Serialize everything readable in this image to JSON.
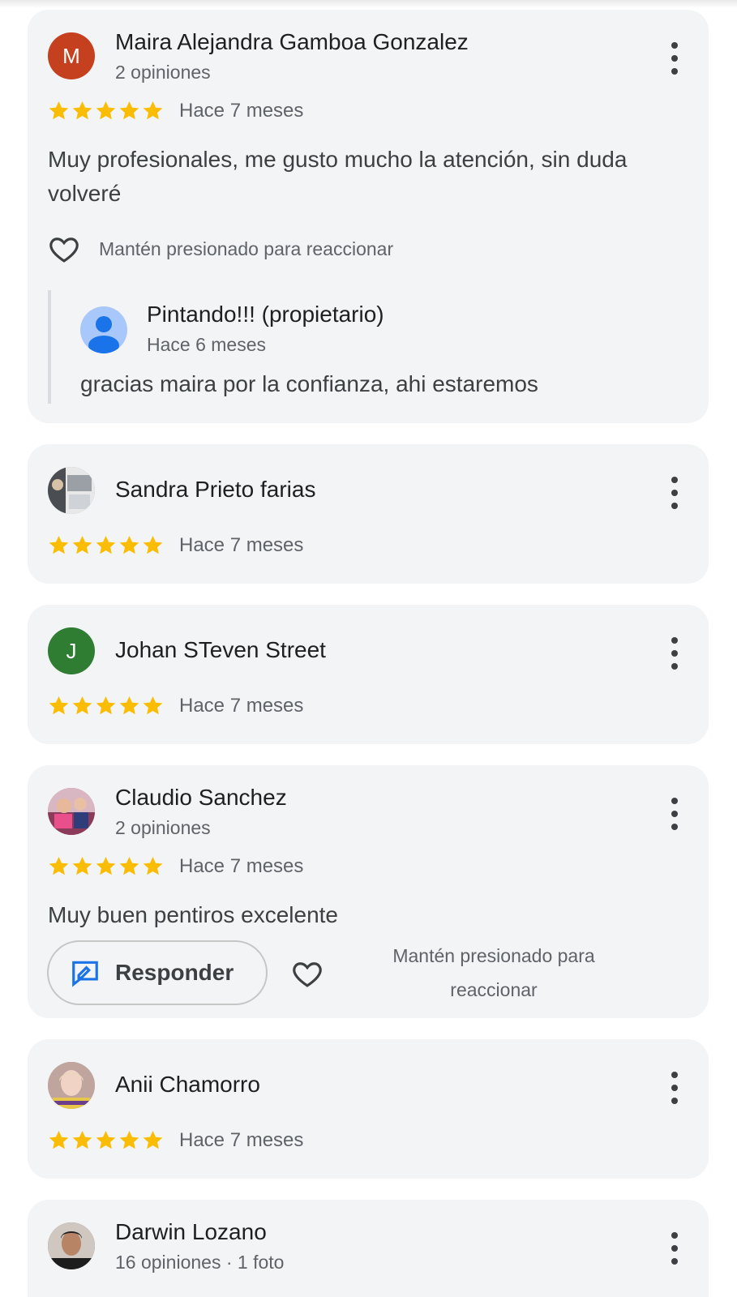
{
  "reviews": [
    {
      "name": "Maira Alejandra Gamboa Gonzalez",
      "initial": "M",
      "avatar_color": "#c5401f",
      "meta": "2 opiniones",
      "rating": 5,
      "date": "Hace 7 meses",
      "text": "Muy profesionales, me gusto mucho la atención, sin duda volveré",
      "react_label": "Mantén presionado para reaccionar",
      "owner_reply": {
        "name": "Pintando!!! (propietario)",
        "date": "Hace 6 meses",
        "text": "gracias maira por la confianza, ahi estaremos"
      }
    },
    {
      "name": "Sandra Prieto farias",
      "avatar": "photo",
      "rating": 5,
      "date": "Hace 7 meses"
    },
    {
      "name": "Johan STeven Street",
      "initial": "J",
      "avatar_color": "#2e7d32",
      "rating": 5,
      "date": "Hace 7 meses"
    },
    {
      "name": "Claudio Sanchez",
      "avatar": "photo",
      "meta": "2 opiniones",
      "rating": 5,
      "date": "Hace 7 meses",
      "text": "Muy buen pentiros excelente",
      "reply_button": "Responder",
      "react_label": "Mantén presionado para reaccionar"
    },
    {
      "name": "Anii Chamorro",
      "avatar": "photo",
      "rating": 5,
      "date": "Hace 7 meses"
    },
    {
      "name": "Darwin Lozano",
      "avatar": "photo",
      "meta": "16 opiniones · 1 foto"
    }
  ],
  "colors": {
    "card_bg": "#f2f4f6",
    "star": "#fbbc04",
    "accent_blue": "#1a73e8"
  }
}
